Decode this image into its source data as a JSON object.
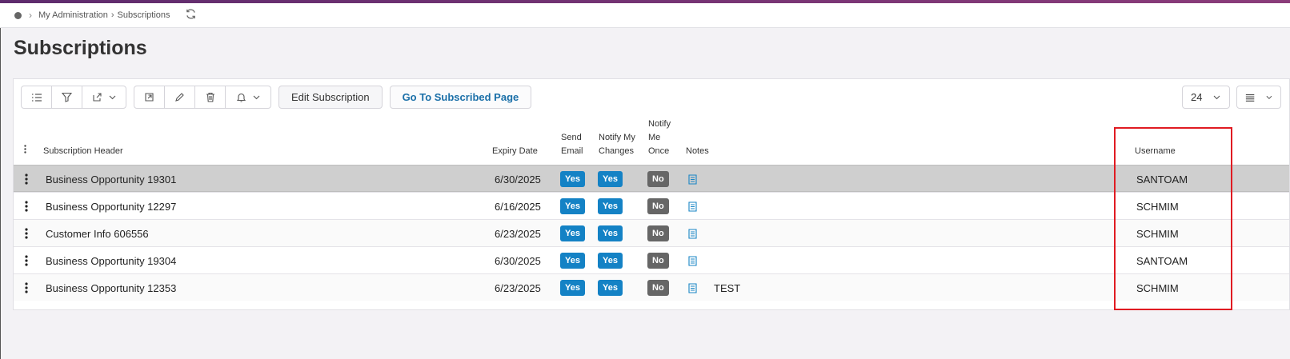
{
  "breadcrumb": {
    "items": [
      "My Administration",
      "Subscriptions"
    ]
  },
  "page": {
    "title": "Subscriptions"
  },
  "toolbar": {
    "edit_subscription": "Edit Subscription",
    "go_to_subscribed_page": "Go To Subscribed Page",
    "page_size": "24"
  },
  "table": {
    "headers": {
      "subscription_header": "Subscription Header",
      "expiry_date": "Expiry Date",
      "send_email_1": "Send",
      "send_email_2": "Email",
      "notify_changes_1": "Notify My",
      "notify_changes_2": "Changes",
      "notify_once_1": "Notify",
      "notify_once_2": "Me",
      "notify_once_3": "Once",
      "notes": "Notes",
      "username": "Username"
    },
    "rows": [
      {
        "header": "Business Opportunity 19301",
        "expiry": "6/30/2025",
        "send_email": "Yes",
        "notify_changes": "Yes",
        "notify_once": "No",
        "notes": "",
        "username": "SANTOAM"
      },
      {
        "header": "Business Opportunity 12297",
        "expiry": "6/16/2025",
        "send_email": "Yes",
        "notify_changes": "Yes",
        "notify_once": "No",
        "notes": "",
        "username": "SCHMIM"
      },
      {
        "header": "Customer Info 606556",
        "expiry": "6/23/2025",
        "send_email": "Yes",
        "notify_changes": "Yes",
        "notify_once": "No",
        "notes": "",
        "username": "SCHMIM"
      },
      {
        "header": "Business Opportunity 19304",
        "expiry": "6/30/2025",
        "send_email": "Yes",
        "notify_changes": "Yes",
        "notify_once": "No",
        "notes": "",
        "username": "SANTOAM"
      },
      {
        "header": "Business Opportunity 12353",
        "expiry": "6/23/2025",
        "send_email": "Yes",
        "notify_changes": "Yes",
        "notify_once": "No",
        "notes": "TEST",
        "username": "SCHMIM"
      }
    ]
  },
  "colors": {
    "accent": "#1482c5",
    "highlight": "#e01b22",
    "badge_no": "#666666"
  }
}
